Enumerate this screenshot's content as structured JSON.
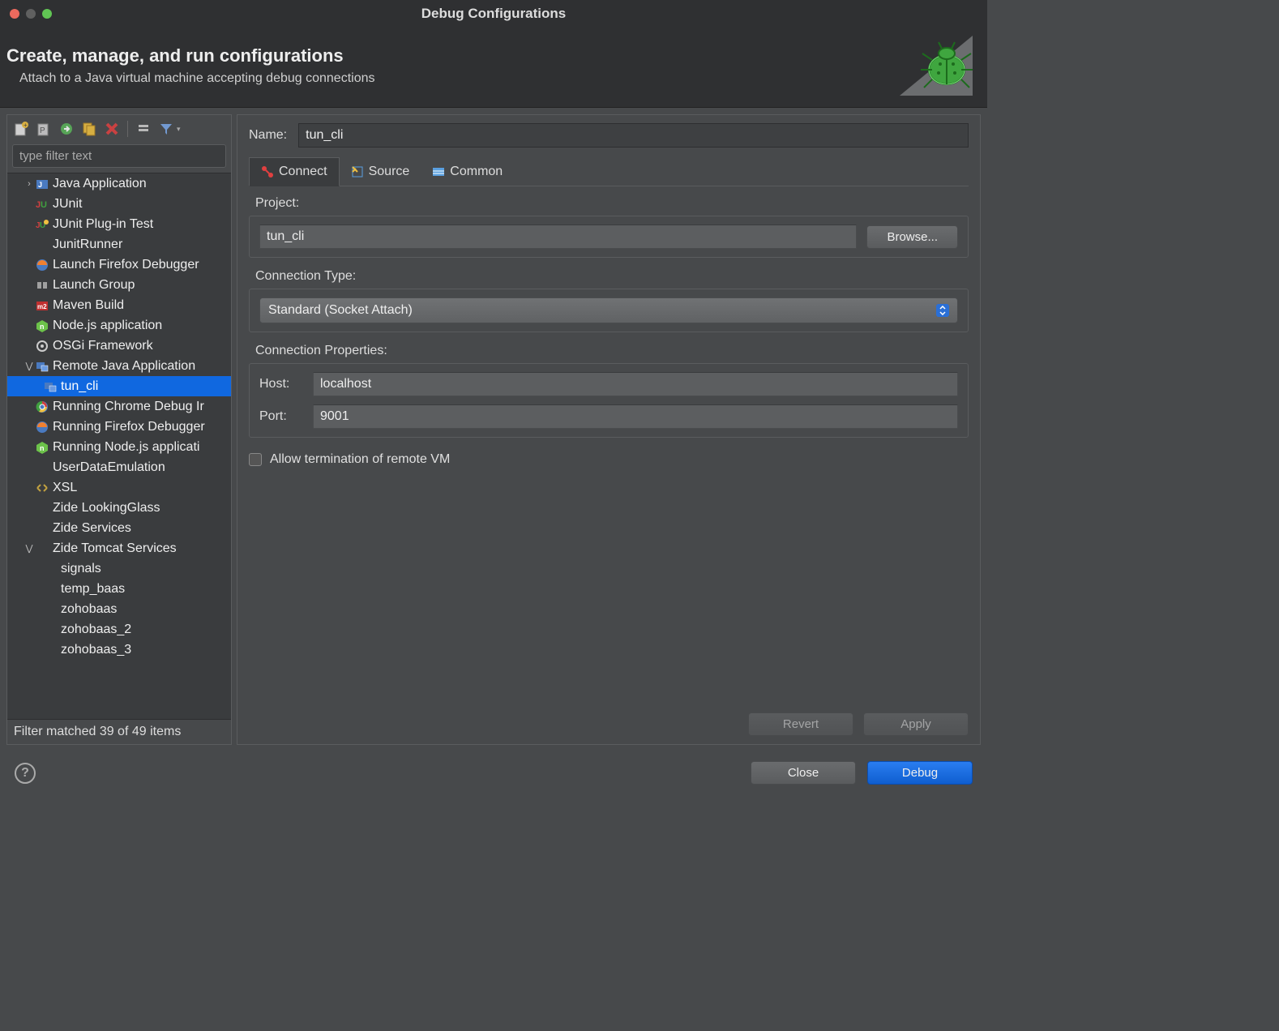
{
  "window": {
    "title": "Debug Configurations"
  },
  "header": {
    "title": "Create, manage, and run configurations",
    "subtitle": "Attach to a Java virtual machine accepting debug connections"
  },
  "sidebar": {
    "filter_placeholder": "type filter text",
    "status": "Filter matched 39 of 49 items",
    "items": [
      {
        "label": "Java Application",
        "icon": "java",
        "indent": 1,
        "twisty": "closed"
      },
      {
        "label": "JUnit",
        "icon": "junit",
        "indent": 1
      },
      {
        "label": "JUnit Plug-in Test",
        "icon": "junit-plugin",
        "indent": 1
      },
      {
        "label": "JunitRunner",
        "icon": "",
        "indent": 1
      },
      {
        "label": "Launch Firefox Debugger",
        "icon": "firefox",
        "indent": 1
      },
      {
        "label": "Launch Group",
        "icon": "group",
        "indent": 1
      },
      {
        "label": "Maven Build",
        "icon": "maven",
        "indent": 1
      },
      {
        "label": "Node.js application",
        "icon": "node",
        "indent": 1
      },
      {
        "label": "OSGi Framework",
        "icon": "osgi",
        "indent": 1
      },
      {
        "label": "Remote Java Application",
        "icon": "remote",
        "indent": 1,
        "twisty": "open"
      },
      {
        "label": "tun_cli",
        "icon": "remote",
        "indent": 2,
        "selected": true
      },
      {
        "label": "Running Chrome Debug Ir",
        "icon": "chrome",
        "indent": 1
      },
      {
        "label": "Running Firefox Debugger",
        "icon": "firefox",
        "indent": 1
      },
      {
        "label": "Running Node.js applicati",
        "icon": "node",
        "indent": 1
      },
      {
        "label": "UserDataEmulation",
        "icon": "",
        "indent": 1
      },
      {
        "label": "XSL",
        "icon": "xsl",
        "indent": 1
      },
      {
        "label": "Zide LookingGlass",
        "icon": "",
        "indent": 1
      },
      {
        "label": "Zide Services",
        "icon": "",
        "indent": 1
      },
      {
        "label": "Zide Tomcat Services",
        "icon": "",
        "indent": 1,
        "twisty": "open"
      },
      {
        "label": "signals",
        "icon": "",
        "indent": 2
      },
      {
        "label": "temp_baas",
        "icon": "",
        "indent": 2
      },
      {
        "label": "zohobaas",
        "icon": "",
        "indent": 2
      },
      {
        "label": "zohobaas_2",
        "icon": "",
        "indent": 2
      },
      {
        "label": "zohobaas_3",
        "icon": "",
        "indent": 2
      }
    ]
  },
  "main": {
    "name_label": "Name:",
    "name_value": "tun_cli",
    "tabs": [
      {
        "label": "Connect",
        "active": true
      },
      {
        "label": "Source"
      },
      {
        "label": "Common"
      }
    ],
    "project_label": "Project:",
    "project_value": "tun_cli",
    "browse_label": "Browse...",
    "conn_type_label": "Connection Type:",
    "conn_type_value": "Standard (Socket Attach)",
    "conn_props_label": "Connection Properties:",
    "host_label": "Host:",
    "host_value": "localhost",
    "port_label": "Port:",
    "port_value": "9001",
    "terminate_label": "Allow termination of remote VM",
    "revert_label": "Revert",
    "apply_label": "Apply"
  },
  "footer": {
    "close_label": "Close",
    "debug_label": "Debug"
  }
}
